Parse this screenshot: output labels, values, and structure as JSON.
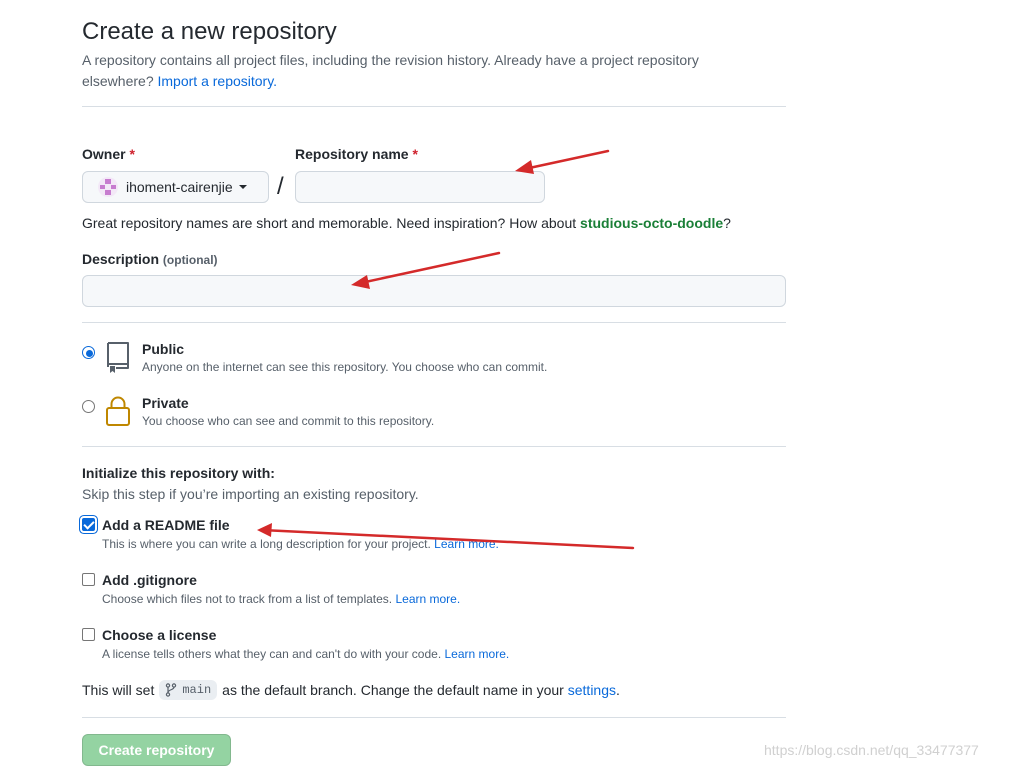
{
  "header": {
    "title": "Create a new repository",
    "subtitle": "A repository contains all project files, including the revision history. Already have a project repository elsewhere?",
    "import_link": "Import a repository."
  },
  "owner": {
    "label": "Owner",
    "required_mark": "*",
    "selected": "ihoment-cairenjie",
    "icon": "identicon-avatar"
  },
  "separator": "/",
  "repo_name": {
    "label": "Repository name",
    "required_mark": "*",
    "value": ""
  },
  "name_hint": {
    "text": "Great repository names are short and memorable. Need inspiration? How about",
    "suggestion": "studious-octo-doodle",
    "suffix": "?"
  },
  "description": {
    "label": "Description",
    "optional": "(optional)",
    "value": ""
  },
  "visibility": {
    "public": {
      "title": "Public",
      "desc": "Anyone on the internet can see this repository. You choose who can commit.",
      "icon": "repo-icon",
      "checked": true
    },
    "private": {
      "title": "Private",
      "desc": "You choose who can see and commit to this repository.",
      "icon": "lock-icon",
      "checked": false
    }
  },
  "init": {
    "title": "Initialize this repository with:",
    "desc": "Skip this step if you’re importing an existing repository.",
    "readme": {
      "title": "Add a README file",
      "desc": "This is where you can write a long description for your project.",
      "link": "Learn more.",
      "checked": true
    },
    "gitignore": {
      "title": "Add .gitignore",
      "desc": "Choose which files not to track from a list of templates.",
      "link": "Learn more.",
      "checked": false
    },
    "license": {
      "title": "Choose a license",
      "desc": "A license tells others what they can and can't do with your code.",
      "link": "Learn more.",
      "checked": false
    }
  },
  "branch": {
    "prefix": "This will set",
    "name": "main",
    "middle": "as the default branch. Change the default name in your",
    "link": "settings",
    "suffix": "."
  },
  "submit": {
    "label": "Create repository"
  },
  "watermark": "https://blog.csdn.net/qq_33477377",
  "colors": {
    "link": "#0969da",
    "suggestion": "#1a7f37",
    "required": "#cf222e",
    "submit_disabled": "#94d3a2",
    "annotation_arrow": "#d42a2a"
  }
}
